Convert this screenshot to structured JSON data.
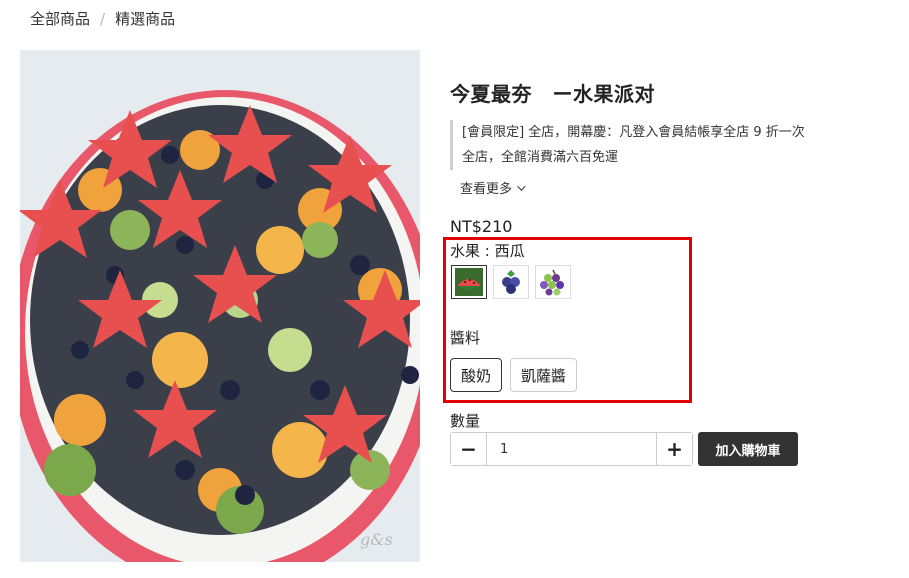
{
  "breadcrumb": {
    "items": [
      "全部商品",
      "精選商品"
    ],
    "separator": "/"
  },
  "product": {
    "title": "今夏最夯　ー水果派对",
    "promo_lines": [
      "[會員限定] 全店，開幕慶：凡登入會員結帳享全店 9 折一次",
      "全店，全館消費滿六百免運"
    ],
    "more_label": "查看更多",
    "price": "NT$210"
  },
  "variants": {
    "fruit_label": "水果 : 西瓜",
    "fruit_options": [
      {
        "name": "watermelon",
        "selected": true
      },
      {
        "name": "blueberry",
        "selected": false
      },
      {
        "name": "grape",
        "selected": false
      }
    ],
    "sauce_label": "醬料",
    "sauce_options": [
      {
        "label": "酸奶",
        "selected": true
      },
      {
        "label": "凱薩醬",
        "selected": false
      }
    ]
  },
  "quantity": {
    "label": "數量",
    "value": "1",
    "minus": "−",
    "plus": "+"
  },
  "cart": {
    "add_label": "加入購物車"
  },
  "colors": {
    "highlight": "#e30000",
    "dark_button": "#333333"
  }
}
